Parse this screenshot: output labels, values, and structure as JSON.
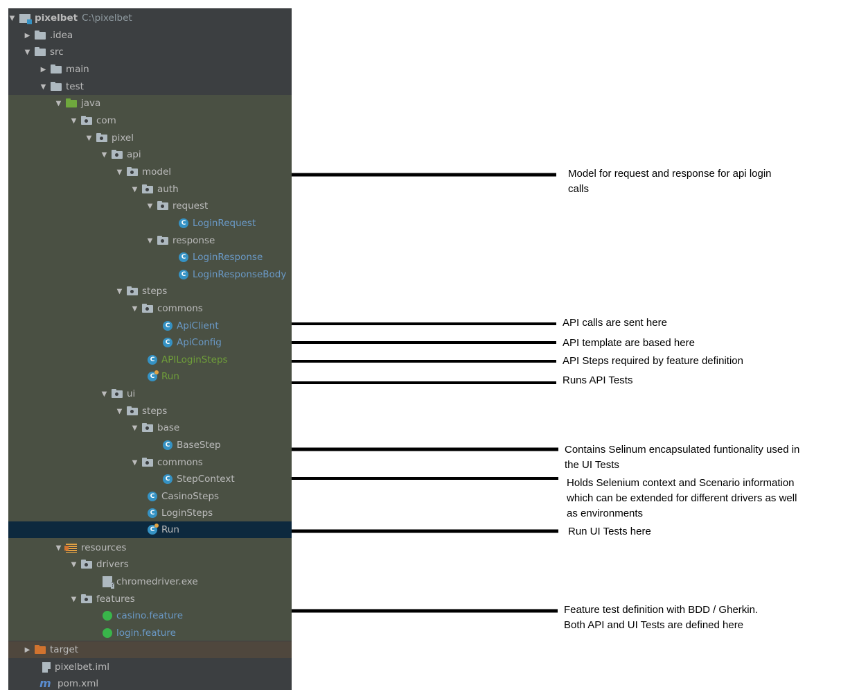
{
  "tree": {
    "project": {
      "name": "pixelbet",
      "path": "C:\\pixelbet"
    },
    "idea": ".idea",
    "src": "src",
    "main": "main",
    "test": "test",
    "java": "java",
    "com": "com",
    "pixel": "pixel",
    "api": "api",
    "model": "model",
    "auth": "auth",
    "request": "request",
    "login_request": "LoginRequest",
    "response": "response",
    "login_response": "LoginResponse",
    "login_response_body": "LoginResponseBody",
    "api_steps": "steps",
    "api_commons": "commons",
    "api_client": "ApiClient",
    "api_config": "ApiConfig",
    "api_login_steps": "APILoginSteps",
    "api_run": "Run",
    "ui": "ui",
    "ui_steps": "steps",
    "base": "base",
    "base_step": "BaseStep",
    "ui_commons": "commons",
    "step_context": "StepContext",
    "casino_steps": "CasinoSteps",
    "login_steps": "LoginSteps",
    "ui_run": "Run",
    "resources": "resources",
    "drivers": "drivers",
    "chromedriver": "chromedriver.exe",
    "features": "features",
    "casino_feature": "casino.feature",
    "login_feature": "login.feature",
    "target": "target",
    "iml": "pixelbet.iml",
    "pom": "pom.xml"
  },
  "annotations": {
    "model": [
      "Model for request and response for api login",
      "calls"
    ],
    "api_client": [
      "API calls are sent here"
    ],
    "api_config": [
      "API template are based here"
    ],
    "api_steps": [
      "API Steps required by feature definition"
    ],
    "api_run": [
      "Runs API Tests"
    ],
    "base_step": [
      "Contains Selinum encapsulated funtionality used in",
      "the UI Tests"
    ],
    "step_context": [
      "Holds Selenium context and Scenario information",
      "which can be extended for different drivers as well",
      "as environments"
    ],
    "ui_run": [
      "Run UI Tests here"
    ],
    "features": [
      "Feature test definition with BDD / Gherkin.",
      "Both API and UI Tests are defined here"
    ]
  },
  "colors": {
    "panel": "#3c3f41",
    "test_source_band": "#4a5043",
    "excluded_band": "#4f473d",
    "selection": "#0d293e",
    "class_text": "#6a99c6",
    "modified_text": "#6f9e3a",
    "connector": "#000000"
  }
}
